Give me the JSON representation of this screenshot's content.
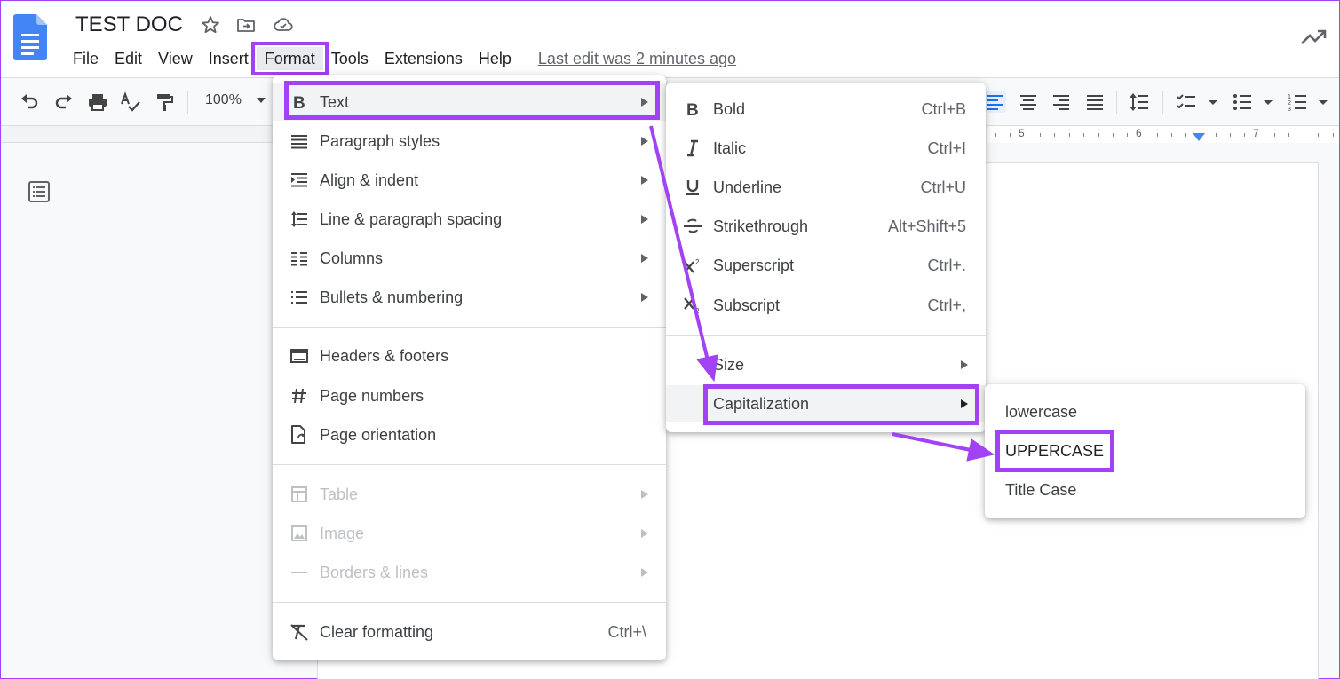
{
  "header": {
    "doc_title": "TEST DOC",
    "icons": [
      "docs-logo-icon",
      "star-icon",
      "move-to-folder-icon",
      "cloud-saved-icon",
      "activity-trend-icon"
    ],
    "menus": [
      "File",
      "Edit",
      "View",
      "Insert",
      "Format",
      "Tools",
      "Extensions",
      "Help"
    ],
    "active_menu": "Format",
    "last_edit": "Last edit was 2 minutes ago"
  },
  "toolbar": {
    "zoom": "100%",
    "icons": [
      "undo-icon",
      "redo-icon",
      "print-icon",
      "spellcheck-icon",
      "paint-format-icon",
      "align-left-icon",
      "align-center-icon",
      "align-right-icon",
      "justify-icon",
      "line-spacing-icon",
      "checklist-icon",
      "bulleted-list-icon",
      "numbered-list-icon"
    ]
  },
  "ruler": {
    "numbers": [
      "5",
      "6",
      "7"
    ]
  },
  "format_menu": {
    "items": [
      {
        "label": "Text",
        "icon": "bold-b-icon",
        "submenu": true,
        "highlighted": true
      },
      {
        "label": "Paragraph styles",
        "icon": "paragraph-styles-icon",
        "submenu": true
      },
      {
        "label": "Align & indent",
        "icon": "align-indent-icon",
        "submenu": true
      },
      {
        "label": "Line & paragraph spacing",
        "icon": "line-spacing-icon",
        "submenu": true
      },
      {
        "label": "Columns",
        "icon": "columns-icon",
        "submenu": true
      },
      {
        "label": "Bullets & numbering",
        "icon": "bullets-icon",
        "submenu": true
      },
      {
        "label": "Headers & footers",
        "icon": "headers-footers-icon",
        "submenu": false
      },
      {
        "label": "Page numbers",
        "icon": "hash-icon",
        "submenu": false
      },
      {
        "label": "Page orientation",
        "icon": "page-orientation-icon",
        "submenu": false
      },
      {
        "label": "Table",
        "icon": "table-icon",
        "submenu": true,
        "disabled": true
      },
      {
        "label": "Image",
        "icon": "image-icon",
        "submenu": true,
        "disabled": true
      },
      {
        "label": "Borders & lines",
        "icon": "borders-lines-icon",
        "submenu": true,
        "disabled": true
      },
      {
        "label": "Clear formatting",
        "icon": "clear-formatting-icon",
        "shortcut": "Ctrl+\\"
      }
    ]
  },
  "text_menu": {
    "items": [
      {
        "label": "Bold",
        "icon": "bold-icon",
        "shortcut": "Ctrl+B"
      },
      {
        "label": "Italic",
        "icon": "italic-icon",
        "shortcut": "Ctrl+I"
      },
      {
        "label": "Underline",
        "icon": "underline-icon",
        "shortcut": "Ctrl+U"
      },
      {
        "label": "Strikethrough",
        "icon": "strikethrough-icon",
        "shortcut": "Alt+Shift+5"
      },
      {
        "label": "Superscript",
        "icon": "superscript-icon",
        "shortcut": "Ctrl+."
      },
      {
        "label": "Subscript",
        "icon": "subscript-icon",
        "shortcut": "Ctrl+,"
      },
      {
        "label": "Size",
        "submenu": true
      },
      {
        "label": "Capitalization",
        "submenu": true,
        "highlighted": true
      }
    ]
  },
  "capitalization_menu": {
    "items": [
      {
        "label": "lowercase"
      },
      {
        "label": "UPPERCASE",
        "highlighted": true
      },
      {
        "label": "Title Case"
      }
    ]
  },
  "colors": {
    "annotation": "#a142f4",
    "docs_blue": "#4285f4",
    "menu_highlight": "#f1f3f4",
    "disabled_text": "#bdc1c6"
  }
}
